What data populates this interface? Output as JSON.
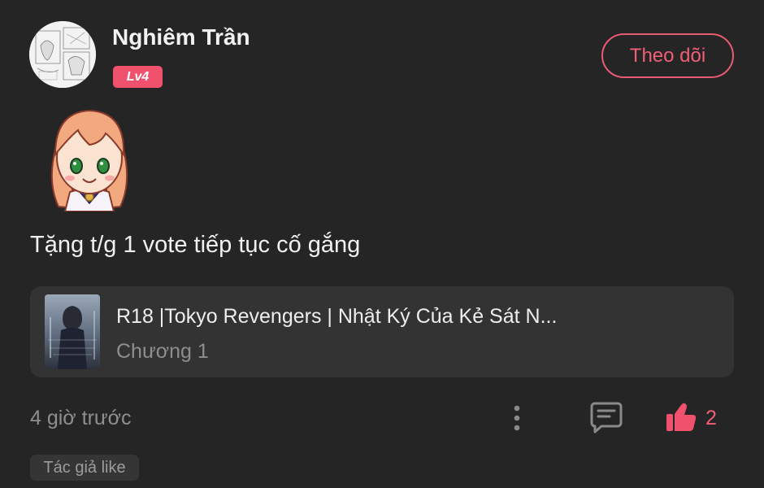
{
  "user": {
    "name": "Nghiêm Trần",
    "level": "Lv4"
  },
  "follow_button": {
    "label": "Theo dõi"
  },
  "comment": {
    "text": "Tặng t/g 1 vote tiếp tục cố gắng",
    "time": "4 giờ trước",
    "like_count": "2",
    "author_liked_tag": "Tác giả like"
  },
  "story": {
    "title": "R18 |Tokyo Revengers | Nhật Ký Của Kẻ Sát N...",
    "chapter": "Chương 1"
  },
  "colors": {
    "background": "#252525",
    "accent": "#f0516d",
    "card": "#333333",
    "muted_text": "#8f8f8f"
  },
  "icons": {
    "more": "more-vertical-icon",
    "reply": "comment-bubble-icon",
    "like": "thumbs-up-icon"
  }
}
